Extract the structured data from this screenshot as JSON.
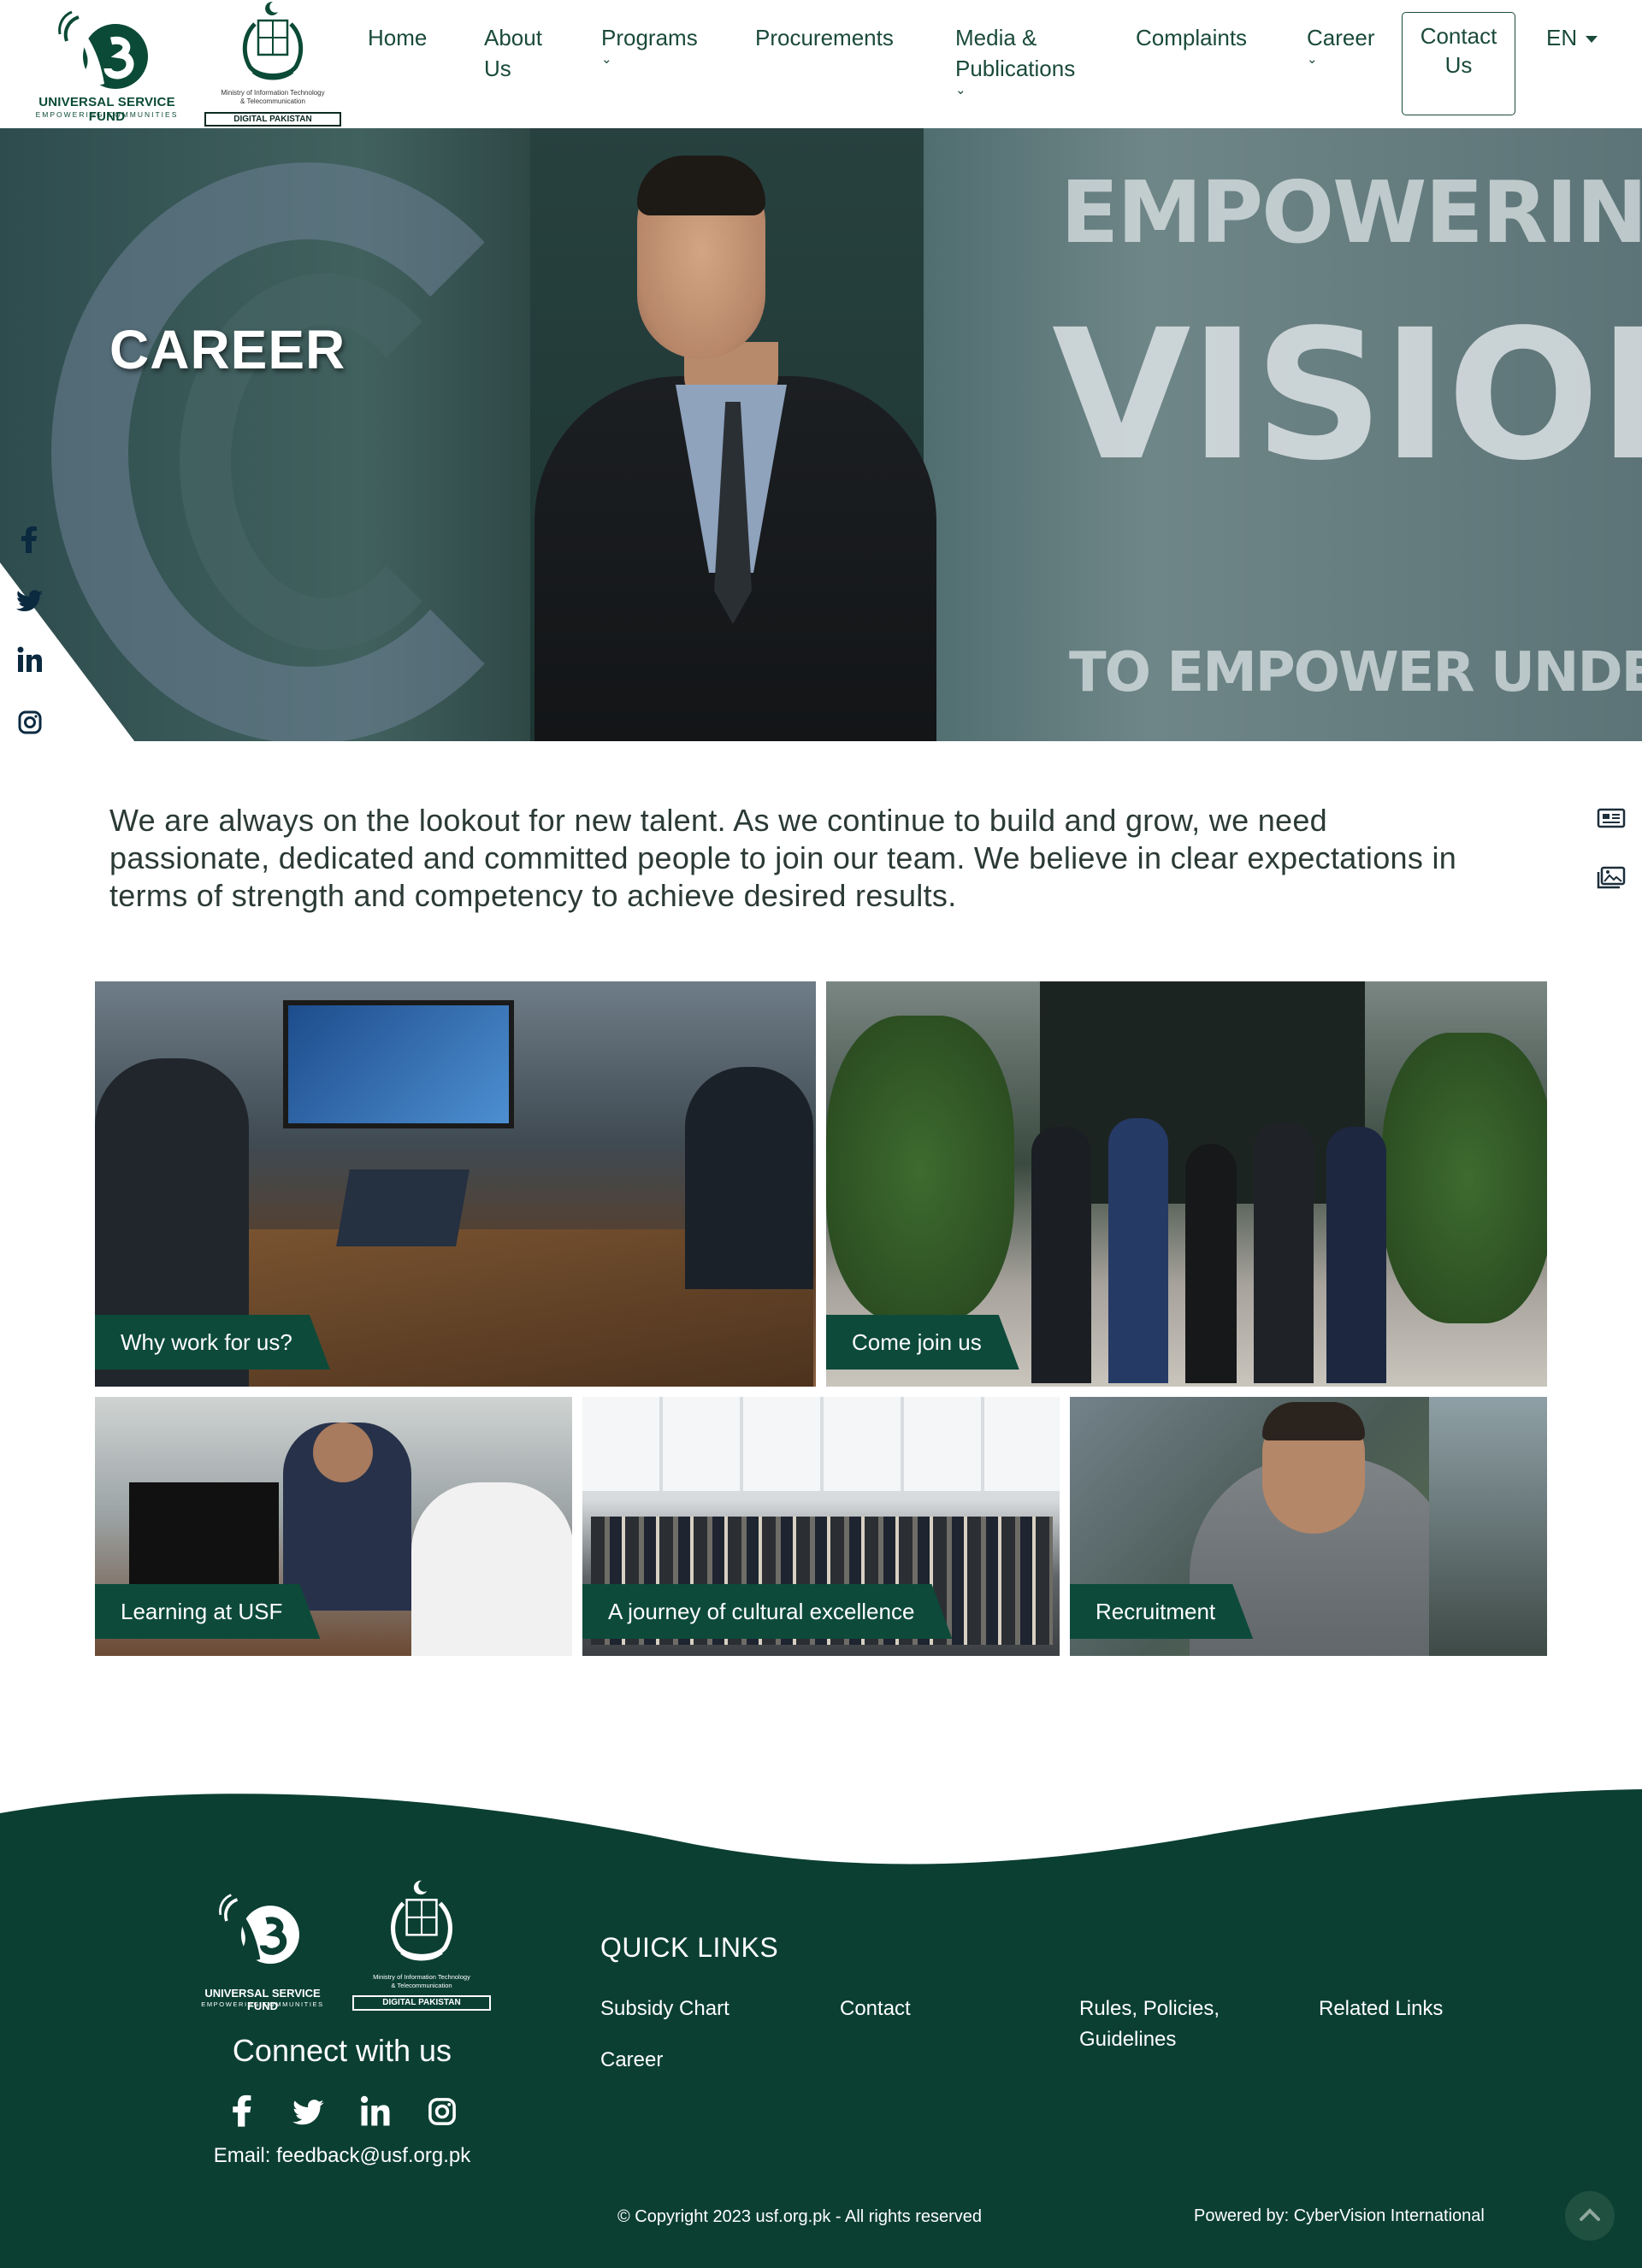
{
  "header": {
    "logo": {
      "name": "UNIVERSAL SERVICE FUND",
      "tagline": "EMPOWERING COMMUNITIES"
    },
    "ministry_logo": {
      "line1": "Ministry of Information Technology",
      "line2": "& Telecommunication",
      "badge": "DIGITAL PAKISTAN"
    },
    "nav": {
      "home": "Home",
      "about_line1": "About",
      "about_line2": "Us",
      "programs": "Programs",
      "procurements": "Procurements",
      "media_line1": "Media &",
      "media_line2": "Publications",
      "complaints": "Complaints",
      "career": "Career",
      "contact_line1": "Contact",
      "contact_line2": "Us",
      "language": "EN"
    }
  },
  "hero": {
    "title": "CAREER",
    "wall_text": {
      "line1": "EMPOWERING COMMUNI",
      "line2": "VISION&MISS",
      "line3": "TO EMPOWER UNDERSERVED"
    }
  },
  "social": [
    "facebook-icon",
    "twitter-icon",
    "linkedin-icon",
    "instagram-icon"
  ],
  "intro": {
    "text": "We are always on the lookout for new talent. As we continue to build and grow, we need passionate, dedicated and committed people to join our team. We believe in clear expectations in terms of strength and competency to achieve desired results."
  },
  "tiles": {
    "why": "Why work for us?",
    "join": "Come join us",
    "learning": "Learning at USF",
    "journey": "A journey of cultural excellence",
    "recruitment": "Recruitment"
  },
  "footer": {
    "connect": "Connect with us",
    "email": "Email: feedback@usf.org.pk",
    "quick_links_title": "QUICK LINKS",
    "links": {
      "subsidy": "Subsidy Chart",
      "contact": "Contact",
      "rules_line1": "Rules, Policies,",
      "rules_line2": "Guidelines",
      "related": "Related Links",
      "career": "Career"
    },
    "copyright": "© Copyright 2023 usf.org.pk - All rights reserved",
    "powered": "Powered by: CyberVision International"
  },
  "colors": {
    "brand_green": "#0b3f32",
    "label_green": "#0d4a3a",
    "nav_text": "#1a4a3a"
  }
}
